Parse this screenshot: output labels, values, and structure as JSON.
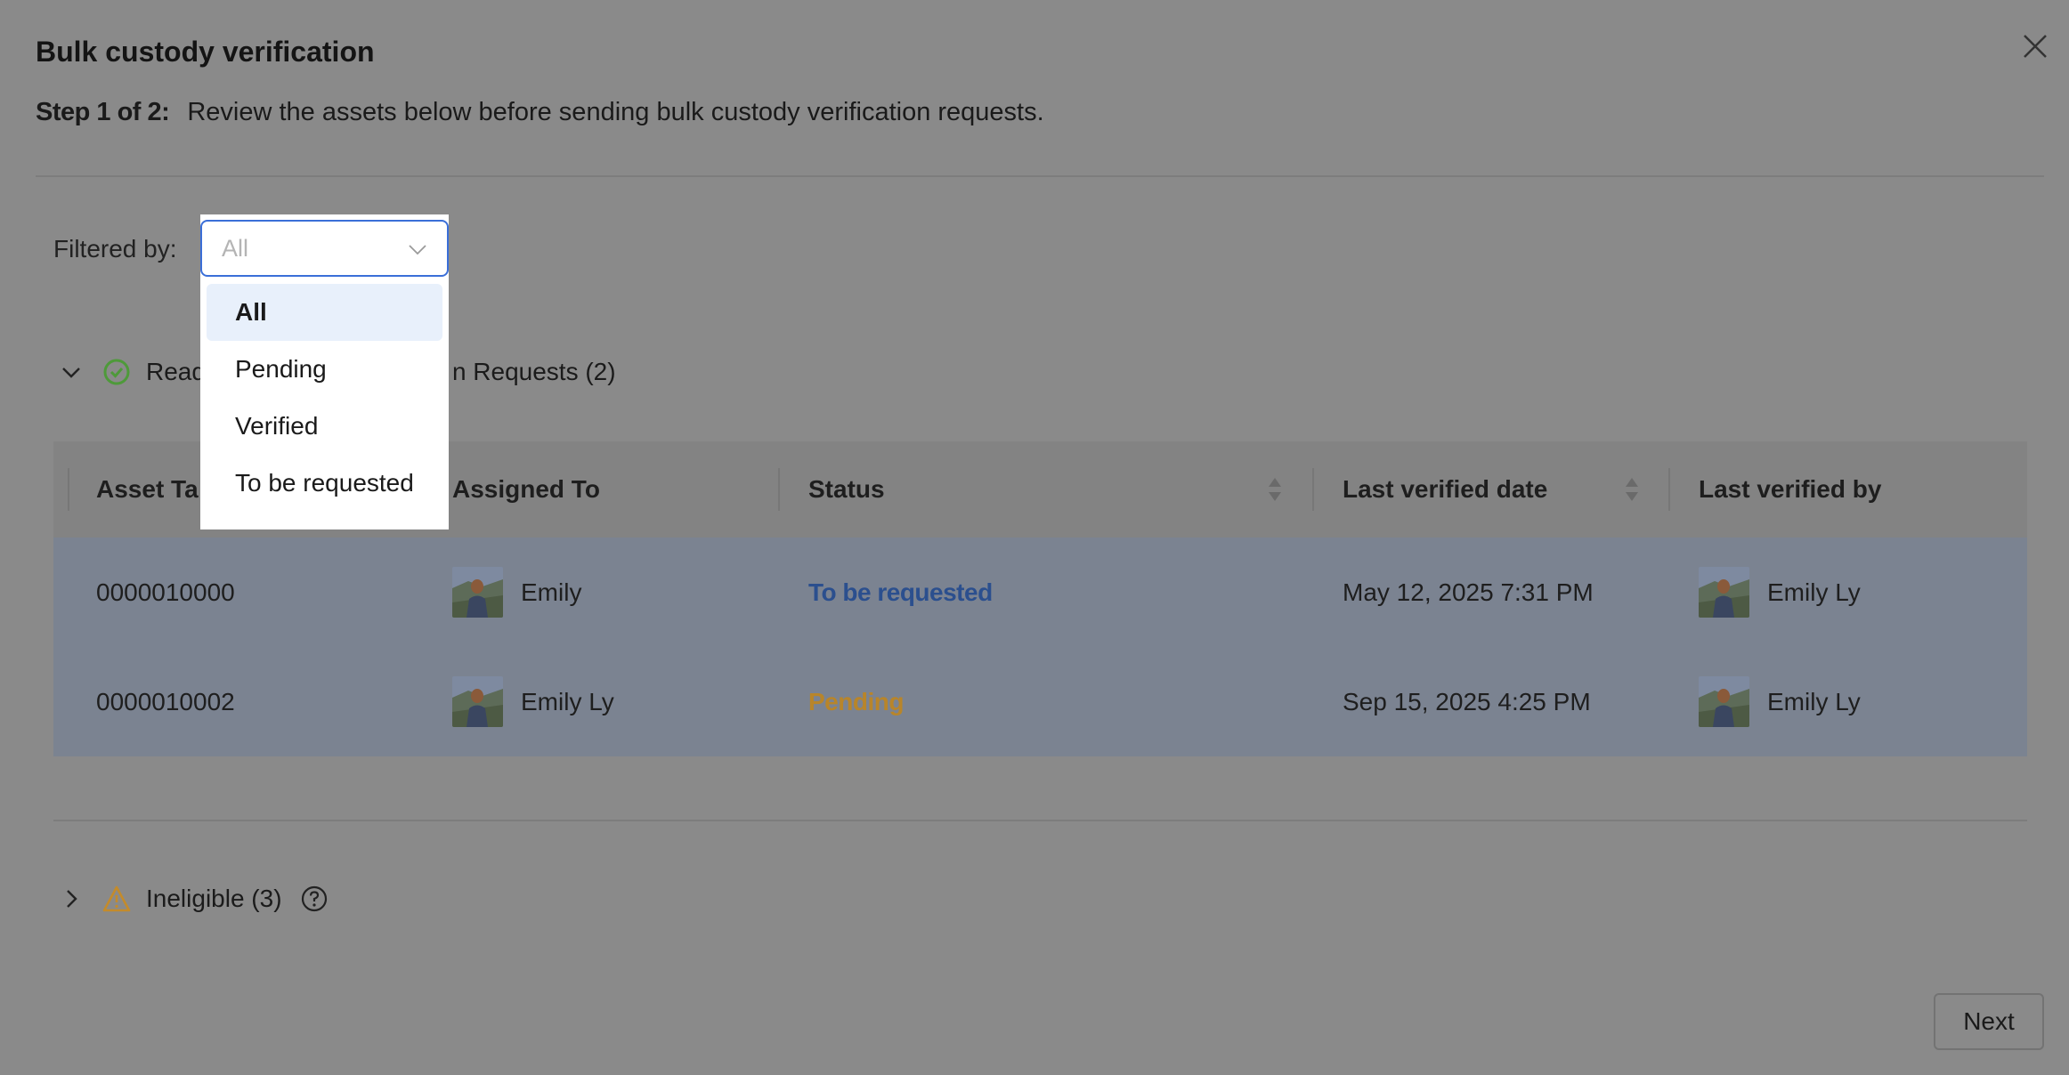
{
  "dialog": {
    "title": "Bulk custody verification",
    "step_label": "Step 1 of 2:",
    "step_text": "Review the assets below before sending bulk custody verification requests."
  },
  "filter": {
    "label": "Filtered by:",
    "placeholder": "All",
    "options": [
      "All",
      "Pending",
      "Verified",
      "To be requested"
    ],
    "selected": "All"
  },
  "sections": {
    "ready": {
      "label_start": "Read",
      "label_end": "n Requests (2)",
      "icon": "check-circle-icon",
      "color": "#4e9a3a"
    },
    "ineligible": {
      "label": "Ineligible (3)",
      "icon": "warning-icon",
      "color": "#c48b2a"
    }
  },
  "table": {
    "columns": [
      "Asset Ta",
      "Assigned To",
      "Status",
      "Last verified date",
      "Last verified by"
    ],
    "rows": [
      {
        "asset_tag": "0000010000",
        "assigned_to": "Emily",
        "status": "To be requested",
        "last_verified_date": "May 12, 2025 7:31 PM",
        "last_verified_by": "Emily Ly"
      },
      {
        "asset_tag": "0000010002",
        "assigned_to": "Emily Ly",
        "status": "Pending",
        "last_verified_date": "Sep 15, 2025 4:25 PM",
        "last_verified_by": "Emily Ly"
      }
    ]
  },
  "footer": {
    "next_label": "Next"
  },
  "colors": {
    "overlay": "#8a8a8a",
    "accent": "#3b6fd8",
    "selected_bg": "#e8f0fb",
    "status_requested": "#2b4f8e",
    "status_pending": "#b8852a"
  }
}
